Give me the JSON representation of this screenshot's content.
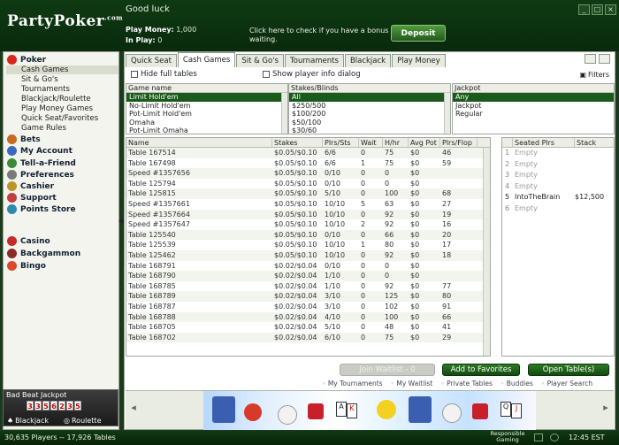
{
  "header": {
    "logo": "PartyPoker",
    "logo_suffix": ".com",
    "greeting": "Good luck",
    "play_money_label": "Play Money:",
    "play_money_value": "1,000",
    "in_play_label": "In Play:",
    "in_play_value": "0",
    "bonus_message": "Click here to check if you have a bonus waiting.",
    "deposit_label": "Deposit",
    "window_controls": [
      "minimize-icon",
      "maximize-icon",
      "close-icon"
    ]
  },
  "sidebar": {
    "poker": {
      "label": "Poker",
      "items": [
        "Cash Games",
        "Sit & Go's",
        "Tournaments",
        "Blackjack/Roulette",
        "Play Money Games",
        "Quick Seat/Favorites",
        "Game Rules"
      ]
    },
    "sections": [
      "Bets",
      "My Account",
      "Tell-a-Friend",
      "Preferences",
      "Cashier",
      "Support",
      "Points Store"
    ],
    "games": [
      "Casino",
      "Backgammon",
      "Bingo"
    ],
    "jackpot": {
      "title": "Bad Beat Jackpot",
      "digits": [
        "3",
        "3",
        "5",
        "6",
        "2",
        "3",
        "5"
      ],
      "blackjack_label": "Blackjack",
      "roulette_label": "Roulette"
    }
  },
  "tabs": [
    "Quick Seat",
    "Cash Games",
    "Sit & Go's",
    "Tournaments",
    "Blackjack",
    "Play Money"
  ],
  "active_tab": "Cash Games",
  "options": {
    "hide_full_tables": "Hide full tables",
    "show_player_info": "Show player info dialog",
    "filters": "Filters"
  },
  "filters": {
    "game_name": {
      "header": "Game name",
      "items": [
        "Limit Hold'em",
        "No-Limit Hold'em",
        "Pot-Limit Hold'em",
        "Omaha",
        "Pot-Limit Omaha"
      ]
    },
    "stakes": {
      "header": "Stakes/Blinds",
      "items": [
        "All",
        "$250/500",
        "$100/200",
        "$50/100",
        "$30/60"
      ]
    },
    "jackpot": {
      "header": "Jackpot",
      "items": [
        "Any",
        "Jackpot",
        "Regular"
      ]
    }
  },
  "grid": {
    "columns": [
      "Name",
      "Stakes",
      "Plrs/Sts",
      "Wait",
      "H/hr",
      "Avg Pot",
      "Plrs/Flop"
    ],
    "rows": [
      [
        "Table  167514",
        "$0.05/$0.10",
        "6/6",
        "0",
        "75",
        "$0",
        "46"
      ],
      [
        "Table  167498",
        "$0.05/$0.10",
        "6/6",
        "1",
        "75",
        "$0",
        "59"
      ],
      [
        "Speed #1357656",
        "$0.05/$0.10",
        "0/10",
        "0",
        "0",
        "$0",
        ""
      ],
      [
        "Table  125794",
        "$0.05/$0.10",
        "0/10",
        "0",
        "0",
        "$0",
        ""
      ],
      [
        "Table  125815",
        "$0.05/$0.10",
        "5/10",
        "0",
        "100",
        "$0",
        "68"
      ],
      [
        "Speed #1357661",
        "$0.05/$0.10",
        "10/10",
        "5",
        "63",
        "$0",
        "27"
      ],
      [
        "Speed #1357664",
        "$0.05/$0.10",
        "10/10",
        "0",
        "92",
        "$0",
        "19"
      ],
      [
        "Speed #1357647",
        "$0.05/$0.10",
        "10/10",
        "2",
        "92",
        "$0",
        "16"
      ],
      [
        "Table  125540",
        "$0.05/$0.10",
        "0/10",
        "0",
        "66",
        "$0",
        "20"
      ],
      [
        "Table  125539",
        "$0.05/$0.10",
        "10/10",
        "1",
        "80",
        "$0",
        "17"
      ],
      [
        "Table  125462",
        "$0.05/$0.10",
        "10/10",
        "0",
        "92",
        "$0",
        "18"
      ],
      [
        "Table  168791",
        "$0.02/$0.04",
        "0/10",
        "0",
        "0",
        "$0",
        ""
      ],
      [
        "Table  168790",
        "$0.02/$0.04",
        "1/10",
        "0",
        "0",
        "$0",
        ""
      ],
      [
        "Table  168785",
        "$0.02/$0.04",
        "1/10",
        "0",
        "92",
        "$0",
        "77"
      ],
      [
        "Table  168789",
        "$0.02/$0.04",
        "3/10",
        "0",
        "125",
        "$0",
        "80"
      ],
      [
        "Table  168787",
        "$0.02/$0.04",
        "3/10",
        "0",
        "102",
        "$0",
        "91"
      ],
      [
        "Table  168788",
        "$0.02/$0.04",
        "4/10",
        "0",
        "100",
        "$0",
        "66"
      ],
      [
        "Table  168705",
        "$0.02/$0.04",
        "5/10",
        "0",
        "48",
        "$0",
        "41"
      ],
      [
        "Table  168702",
        "$0.02/$0.04",
        "6/10",
        "0",
        "75",
        "$0",
        "29"
      ]
    ]
  },
  "seats": {
    "columns": [
      "Seated Plrs",
      "Stack"
    ],
    "rows": [
      [
        "1",
        "Empty",
        ""
      ],
      [
        "2",
        "Empty",
        ""
      ],
      [
        "3",
        "Empty",
        ""
      ],
      [
        "4",
        "Empty",
        ""
      ],
      [
        "5",
        "IntoTheBrain",
        "$12,500"
      ],
      [
        "6",
        "Empty",
        ""
      ]
    ]
  },
  "buttons": {
    "join_waitlist": "Join Waitlist - 0",
    "add_favorites": "Add to Favorites",
    "open_tables": "Open Table(s)"
  },
  "links": [
    "My Tournaments",
    "My Waitlist",
    "Private Tables",
    "Buddies",
    "Player Search"
  ],
  "status": {
    "players_tables": "30,635 Players -- 17,926 Tables",
    "responsible": "Responsible Gaming",
    "clock": "12:45 EST"
  },
  "colors": {
    "brand_green": "#0e3a12",
    "selection": "#1a5a1a",
    "button_green": "#2d7a24"
  }
}
